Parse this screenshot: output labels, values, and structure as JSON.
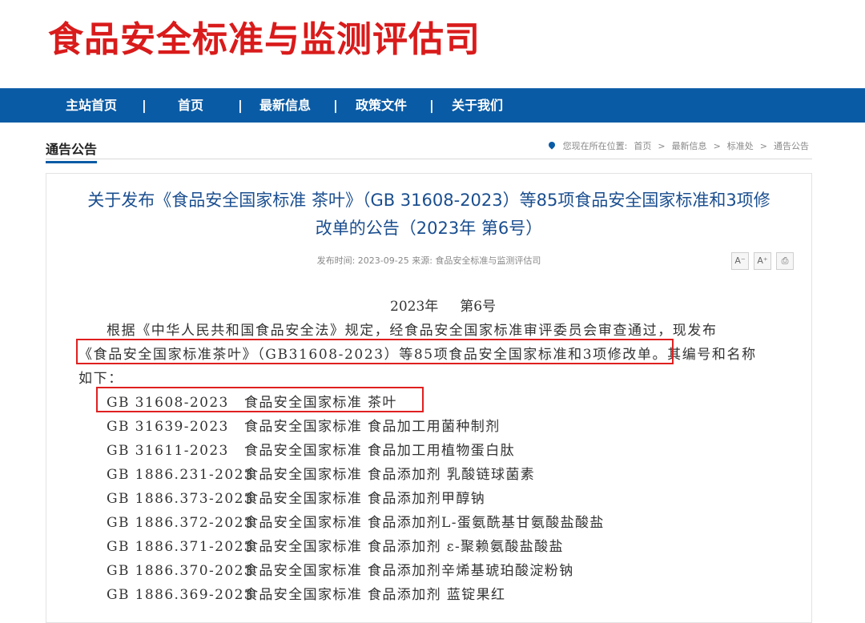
{
  "site": {
    "title": "食品安全标准与监测评估司"
  },
  "nav": {
    "items": [
      "主站首页",
      "首页",
      "最新信息",
      "政策文件",
      "关于我们"
    ],
    "separator": "|"
  },
  "section": {
    "title": "通告公告"
  },
  "breadcrumb": {
    "prefix": "您现在所在位置:",
    "items": [
      "首页",
      "最新信息",
      "标准处",
      "通告公告"
    ],
    "sep": ">"
  },
  "article": {
    "title_line1": "关于发布《食品安全国家标准 茶叶》（GB 31608-2023）等85项食品安全国家标准和3项修",
    "title_line2": "改单的公告（2023年 第6号）",
    "meta": "发布时间:  2023-09-25   来源: 食品安全标准与监测评估司",
    "tools": {
      "font_smaller": "A⁻",
      "font_larger": "A⁺",
      "print": "⎙"
    },
    "issue": "2023年     第6号",
    "para_line1": "根据《中华人民共和国食品安全法》规定，经食品安全国家标准审评委员会审查通过，现发布",
    "para_line2": "《食品安全国家标准茶叶》（GB31608-2023）等85项食品安全国家标准和3项修改单。其编号和名称",
    "para_line3": "如下：",
    "standards": [
      {
        "code": "GB 31608-2023",
        "name": "食品安全国家标准 茶叶"
      },
      {
        "code": "GB 31639-2023",
        "name": "食品安全国家标准 食品加工用菌种制剂"
      },
      {
        "code": "GB 31611-2023",
        "name": "食品安全国家标准 食品加工用植物蛋白肽"
      },
      {
        "code": "GB 1886.231-2023",
        "name": "食品安全国家标准 食品添加剂 乳酸链球菌素"
      },
      {
        "code": "GB 1886.373-2023",
        "name": "食品安全国家标准 食品添加剂甲醇钠"
      },
      {
        "code": "GB 1886.372-2023",
        "name": "食品安全国家标准 食品添加剂L-蛋氨酰基甘氨酸盐酸盐"
      },
      {
        "code": "GB 1886.371-2023",
        "name": "食品安全国家标准 食品添加剂 ε-聚赖氨酸盐酸盐"
      },
      {
        "code": "GB 1886.370-2023",
        "name": "食品安全国家标准 食品添加剂辛烯基琥珀酸淀粉钠"
      },
      {
        "code": "GB 1886.369-2023",
        "name": "食品安全国家标准 食品添加剂 蓝锭果红"
      }
    ]
  },
  "colors": {
    "brand_red": "#d91b1b",
    "nav_blue": "#0a5ba5",
    "title_blue": "#1a4e8f",
    "highlight": "#e02020"
  }
}
